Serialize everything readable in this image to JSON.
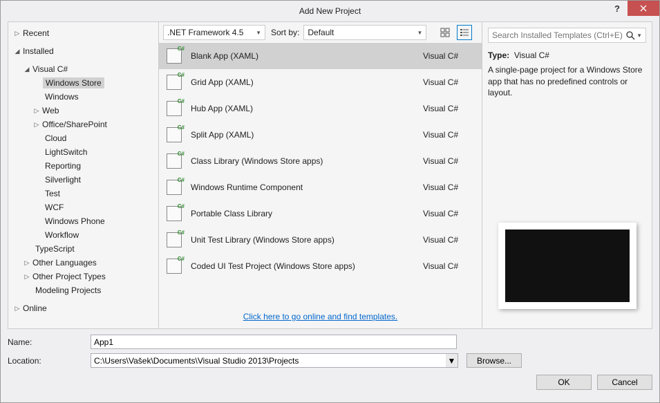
{
  "window": {
    "title": "Add New Project"
  },
  "tree": {
    "recent": "Recent",
    "installed": "Installed",
    "vc": "Visual C#",
    "ws": "Windows Store",
    "win": "Windows",
    "web": "Web",
    "office": "Office/SharePoint",
    "cloud": "Cloud",
    "ls": "LightSwitch",
    "rep": "Reporting",
    "sl": "Silverlight",
    "test": "Test",
    "wcf": "WCF",
    "wp": "Windows Phone",
    "wf": "Workflow",
    "ts": "TypeScript",
    "ol": "Other Languages",
    "opt": "Other Project Types",
    "mp": "Modeling Projects",
    "online": "Online"
  },
  "toolbar": {
    "framework": ".NET Framework 4.5",
    "sort_label": "Sort by:",
    "sort_value": "Default"
  },
  "search": {
    "placeholder": "Search Installed Templates (Ctrl+E)"
  },
  "templates": [
    {
      "name": "Blank App (XAML)",
      "lang": "Visual C#"
    },
    {
      "name": "Grid App (XAML)",
      "lang": "Visual C#"
    },
    {
      "name": "Hub App (XAML)",
      "lang": "Visual C#"
    },
    {
      "name": "Split App (XAML)",
      "lang": "Visual C#"
    },
    {
      "name": "Class Library (Windows Store apps)",
      "lang": "Visual C#"
    },
    {
      "name": "Windows Runtime Component",
      "lang": "Visual C#"
    },
    {
      "name": "Portable Class Library",
      "lang": "Visual C#"
    },
    {
      "name": "Unit Test Library (Windows Store apps)",
      "lang": "Visual C#"
    },
    {
      "name": "Coded UI Test Project (Windows Store apps)",
      "lang": "Visual C#"
    }
  ],
  "online_link": "Click here to go online and find templates.",
  "description": {
    "type_label": "Type:",
    "type_value": "Visual C#",
    "text": "A single-page project for a Windows Store app that has no predefined controls or layout."
  },
  "form": {
    "name_label": "Name:",
    "name_value": "App1",
    "location_label": "Location:",
    "location_value": "C:\\Users\\Vašek\\Documents\\Visual Studio 2013\\Projects",
    "browse": "Browse...",
    "ok": "OK",
    "cancel": "Cancel"
  }
}
